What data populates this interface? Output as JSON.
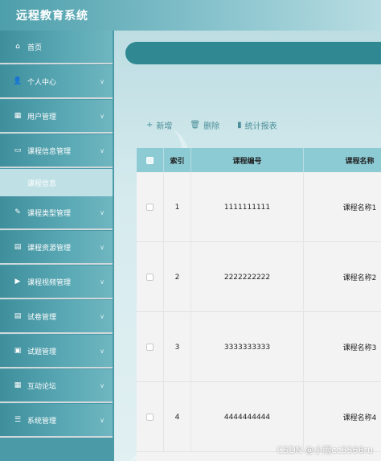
{
  "header": {
    "title": "远程教育系统"
  },
  "sidebar": {
    "items": [
      {
        "label": "首页",
        "icon": "home-icon",
        "glyph": "⌂",
        "has_children": false
      },
      {
        "label": "个人中心",
        "icon": "user-icon",
        "glyph": "👤",
        "has_children": true
      },
      {
        "label": "用户管理",
        "icon": "grid-icon",
        "glyph": "▦",
        "has_children": true
      },
      {
        "label": "课程信息管理",
        "icon": "monitor-icon",
        "glyph": "▭",
        "has_children": true
      },
      {
        "label": "课程类型管理",
        "icon": "edit-icon",
        "glyph": "✎",
        "has_children": true
      },
      {
        "label": "课程资源管理",
        "icon": "chat-icon",
        "glyph": "▤",
        "has_children": true
      },
      {
        "label": "课程视频管理",
        "icon": "video-icon",
        "glyph": "▶",
        "has_children": true
      },
      {
        "label": "试卷管理",
        "icon": "paper-icon",
        "glyph": "▤",
        "has_children": true
      },
      {
        "label": "试题管理",
        "icon": "briefcase-icon",
        "glyph": "▣",
        "has_children": true
      },
      {
        "label": "互动论坛",
        "icon": "forum-icon",
        "glyph": "▦",
        "has_children": true
      },
      {
        "label": "系统管理",
        "icon": "settings-icon",
        "glyph": "☰",
        "has_children": true
      }
    ],
    "sub_item": "课程信息",
    "chevron": "∨"
  },
  "toolbar": {
    "add": {
      "label": "新增",
      "glyph": "+"
    },
    "delete": {
      "label": "删除",
      "glyph": "🗑"
    },
    "report": {
      "label": "统计报表",
      "glyph": "▮"
    }
  },
  "table": {
    "columns": [
      "索引",
      "课程编号",
      "课程名称"
    ],
    "rows": [
      {
        "index": "1",
        "code": "1111111111",
        "name": "课程名称1"
      },
      {
        "index": "2",
        "code": "2222222222",
        "name": "课程名称2"
      },
      {
        "index": "3",
        "code": "3333333333",
        "name": "课程名称3"
      },
      {
        "index": "4",
        "code": "4444444444",
        "name": "课程名称4"
      }
    ]
  },
  "watermark": "CSDN @小雨cc5566ru"
}
